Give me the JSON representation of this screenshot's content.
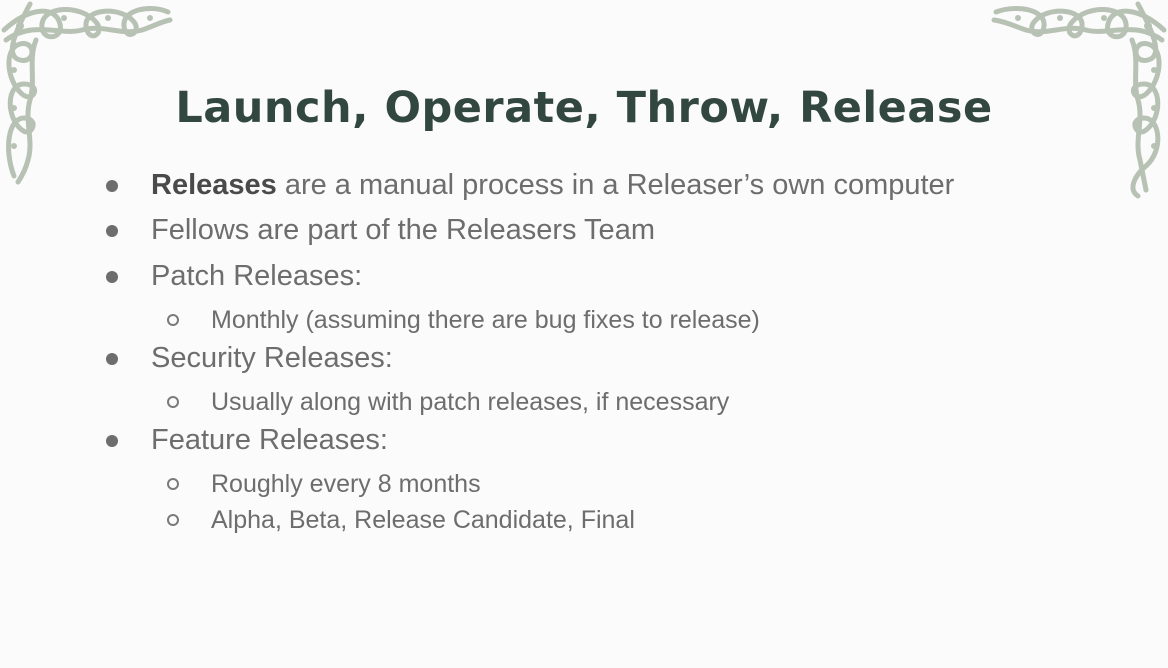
{
  "slide": {
    "title": "Launch, Operate, Throw, Release",
    "accent_color": "#334741",
    "ornament_color": "#b8c2b4",
    "text_color": "#6d6d6d",
    "bullets": [
      {
        "strong": "Releases",
        "text": " are a manual process in a Releaser’s own computer",
        "subitems": []
      },
      {
        "strong": "",
        "text": "Fellows are part of the Releasers Team",
        "subitems": []
      },
      {
        "strong": "",
        "text": "Patch Releases:",
        "subitems": [
          "Monthly (assuming there are bug fixes to release)"
        ]
      },
      {
        "strong": "",
        "text": "Security Releases:",
        "subitems": [
          "Usually along with patch releases, if necessary"
        ]
      },
      {
        "strong": "",
        "text": "Feature Releases:",
        "subitems": [
          "Roughly every 8 months",
          "Alpha, Beta, Release Candidate, Final"
        ]
      }
    ],
    "ornaments": [
      "celtic-knot-corner-left-icon",
      "celtic-knot-corner-right-icon"
    ]
  }
}
